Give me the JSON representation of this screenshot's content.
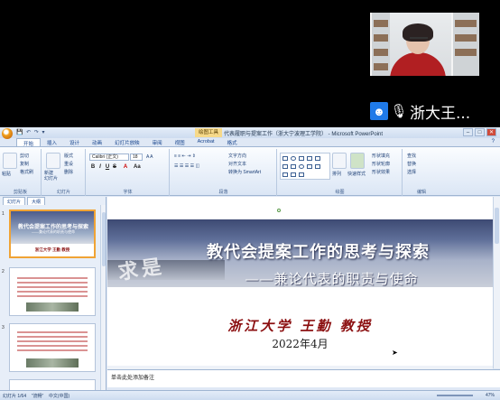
{
  "video": {
    "participant_name": "浙大王..."
  },
  "ppt": {
    "context_tab": "绘图工具",
    "window_title": "代表履职与提案工作（浙大宁波理工学院） - Microsoft PowerPoint",
    "tabs": [
      "开始",
      "插入",
      "设计",
      "动画",
      "幻灯片放映",
      "审阅",
      "视图",
      "Acrobat",
      "格式"
    ],
    "active_tab": "开始",
    "ribbon": {
      "clipboard": {
        "label": "剪贴板",
        "paste": "粘贴",
        "cut": "剪切",
        "copy": "复制",
        "format_painter": "格式刷"
      },
      "slides": {
        "label": "幻灯片",
        "new_slide": "新建\n幻灯片",
        "layout": "版式",
        "reset": "重设",
        "delete": "删除"
      },
      "font": {
        "label": "字体",
        "font_name": "Calibri (正文)",
        "font_size": "18"
      },
      "paragraph": {
        "label": "段落",
        "text_direction": "文字方向",
        "align_text": "对齐文本",
        "smartart": "转换为 SmartArt"
      },
      "drawing": {
        "label": "绘图",
        "arrange": "排列",
        "quick_styles": "快速样式",
        "shape_fill": "形状填充",
        "shape_outline": "形状轮廓",
        "shape_effects": "形状效果"
      },
      "editing": {
        "label": "编辑",
        "find": "查找",
        "replace": "替换",
        "select": "选择"
      }
    },
    "panel_tabs": [
      "幻灯片",
      "大纲"
    ],
    "thumb1": {
      "title": "教代会提案工作的思考与探索",
      "subtitle": "——兼论代表的职责与使命",
      "name": "浙江大学 王勤 教授"
    },
    "slide": {
      "title": "教代会提案工作的思考与探索",
      "subtitle": "——兼论代表的职责与使命",
      "author": "浙江大学 王勤 教授",
      "date": "2022年4月",
      "stamp": "求是新"
    },
    "notes_placeholder": "单击此处添加备注",
    "status": {
      "slide_info": "幻灯片 1/64",
      "theme": "\"流畅\"",
      "lang": "中文(中国)",
      "zoom": "47%"
    }
  }
}
